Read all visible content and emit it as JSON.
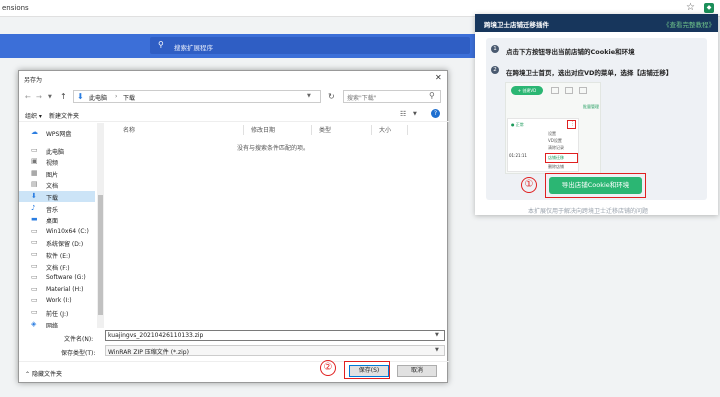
{
  "browser": {
    "url_fragment": "ensions"
  },
  "extensions_page": {
    "search_placeholder": "搜索扩展程序"
  },
  "dialog": {
    "title": "另存为",
    "breadcrumb": [
      "此电脑",
      "下载"
    ],
    "search_placeholder": "搜索\"下载\"",
    "toolbar": {
      "organize": "组织 ▾",
      "new_folder": "新建文件夹"
    },
    "sidebar": [
      {
        "label": "WPS网盘",
        "icon": "cloud-icon"
      },
      {
        "label": "此电脑",
        "icon": "computer-icon"
      },
      {
        "label": "视频",
        "icon": "video-folder-icon"
      },
      {
        "label": "图片",
        "icon": "picture-folder-icon"
      },
      {
        "label": "文档",
        "icon": "document-folder-icon"
      },
      {
        "label": "下载",
        "icon": "download-folder-icon",
        "selected": true
      },
      {
        "label": "音乐",
        "icon": "music-folder-icon"
      },
      {
        "label": "桌面",
        "icon": "desktop-folder-icon"
      },
      {
        "label": "Win10x64 (C:)",
        "icon": "drive-icon"
      },
      {
        "label": "系统保留 (D:)",
        "icon": "drive-icon"
      },
      {
        "label": "软件 (E:)",
        "icon": "drive-icon"
      },
      {
        "label": "文档 (F:)",
        "icon": "drive-icon"
      },
      {
        "label": "Software (G:)",
        "icon": "drive-icon"
      },
      {
        "label": "Material (H:)",
        "icon": "drive-icon"
      },
      {
        "label": "Work (I:)",
        "icon": "drive-icon"
      },
      {
        "label": "前任 (J:)",
        "icon": "drive-icon"
      },
      {
        "label": "网络",
        "icon": "network-icon"
      }
    ],
    "columns": [
      "名称",
      "修改日期",
      "类型",
      "大小"
    ],
    "empty_message": "没有与搜索条件匹配的项。",
    "filename_label": "文件名(N):",
    "filename_value": "kuajingvs_20210426110133.zip",
    "filetype_label": "保存类型(T):",
    "filetype_value": "WinRAR ZIP 压缩文件 (*.zip)",
    "hide_folders": "隐藏文件夹",
    "save_label": "保存(S)",
    "cancel_label": "取消",
    "marker": "②"
  },
  "popup": {
    "title": "跨境卫士店铺迁移插件",
    "help_link": "《查看完整教程》",
    "step1_num": "1",
    "step1": "点击下方按钮导出当前店铺的Cookie和环境",
    "step2_num": "2",
    "step2": "在跨境卫士首页，选出对应VD的菜单，选择【店铺迁移】",
    "screenshot": {
      "top_button": "+ 创建VD",
      "link": "批量管理",
      "status": "● 正常",
      "menu_dots": "⋮",
      "menu_items": [
        "设置",
        "VD设置",
        "清除记录",
        "店铺迁移",
        "删除店铺"
      ],
      "timer": "01:21:11"
    },
    "marker": "①",
    "export_button": "导出店铺Cookie和环境",
    "footer": "本扩展仅用于解决向跨境卫士迁移店铺的问题"
  },
  "colors": {
    "accent_green": "#2bb673",
    "highlight_red": "#e02020",
    "popup_header": "#17365c",
    "chrome_blue": "#3c6fd8"
  }
}
